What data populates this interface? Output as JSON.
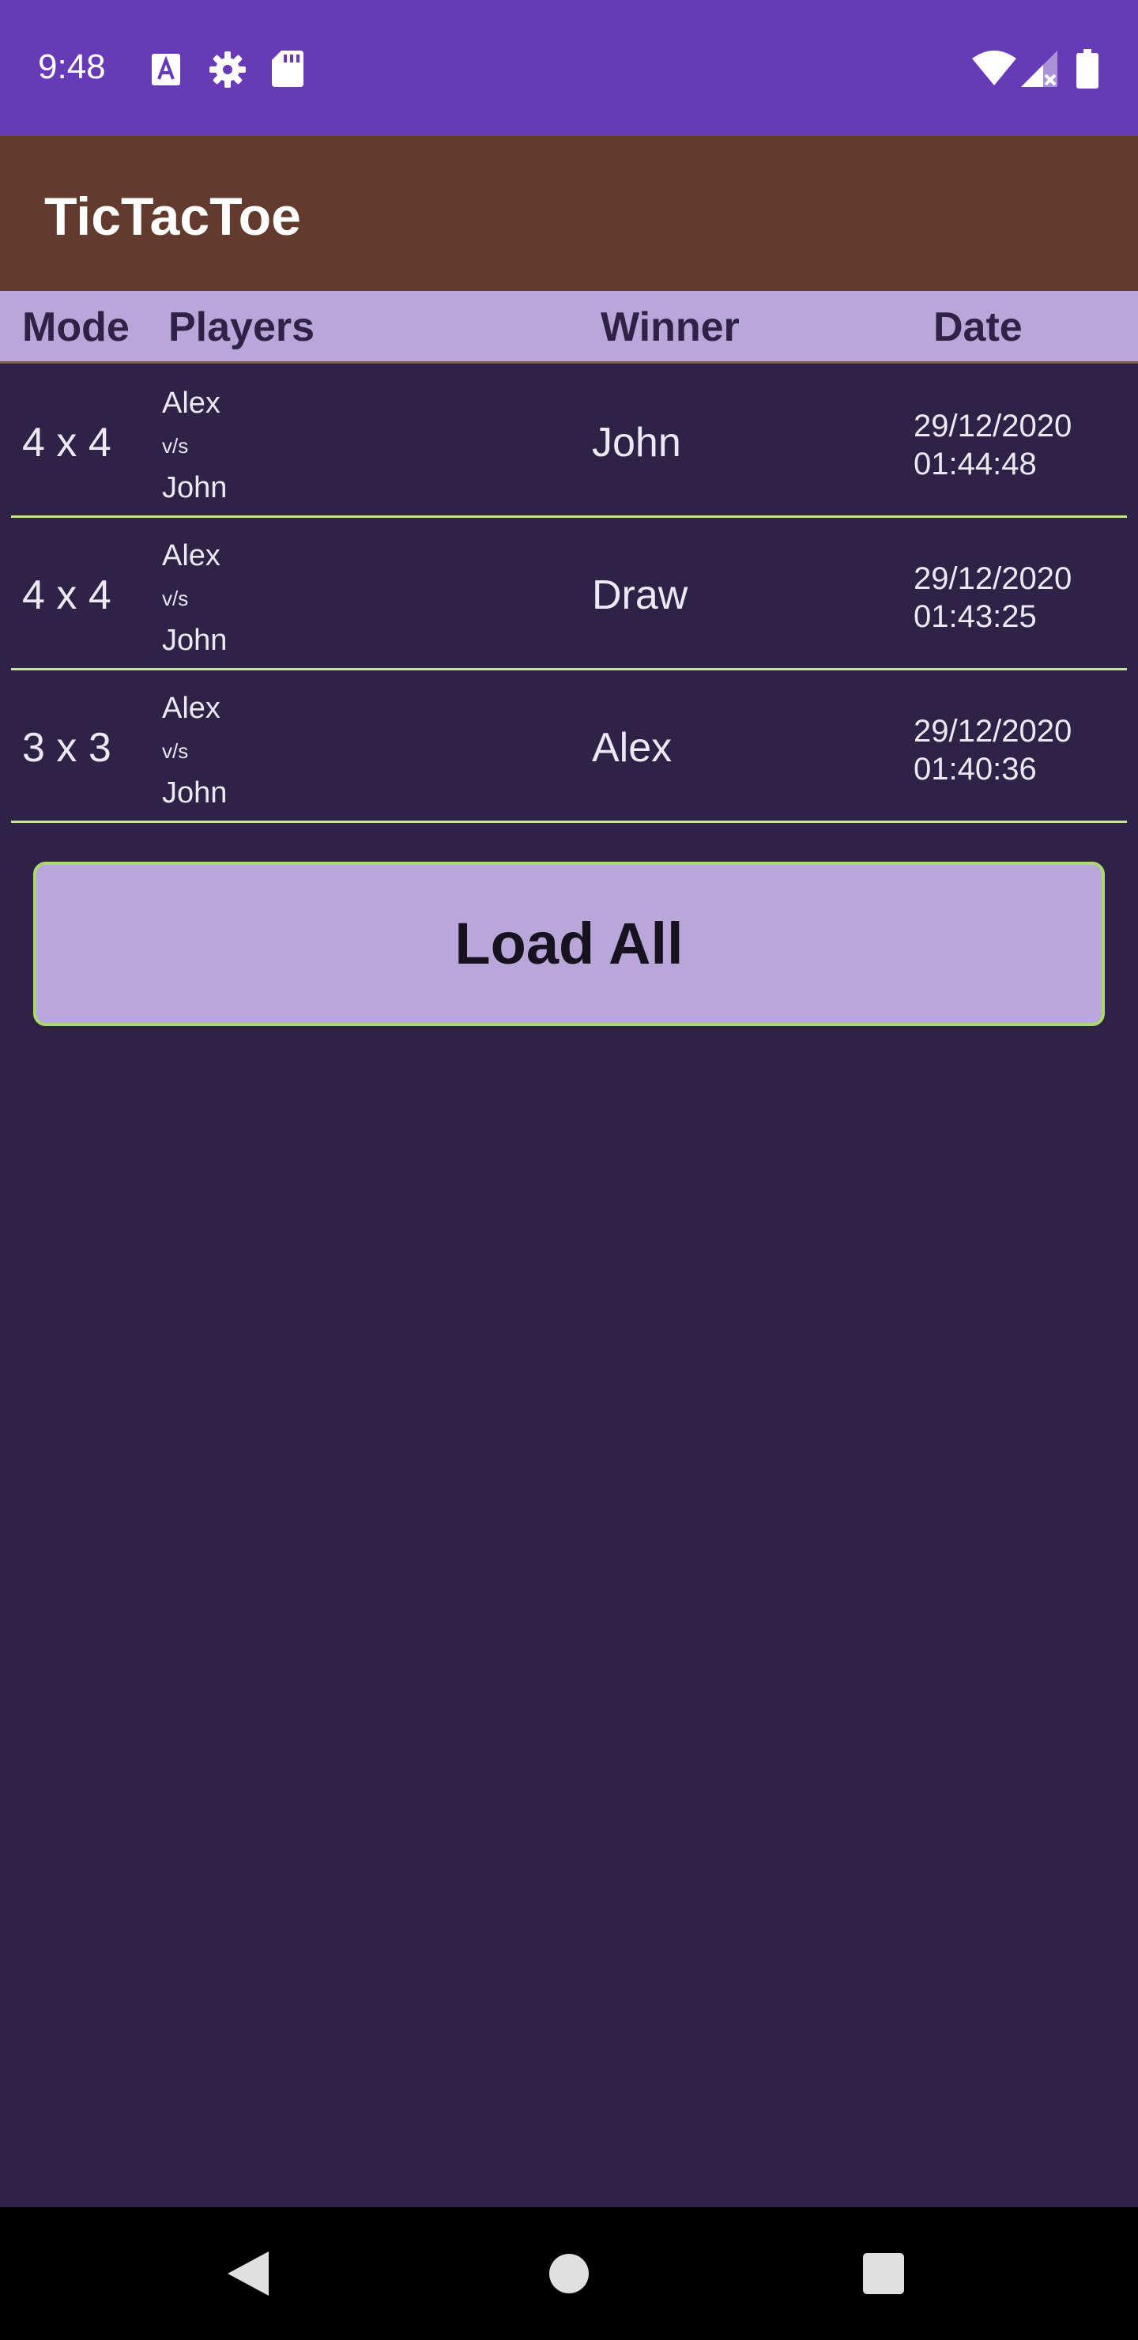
{
  "status_bar": {
    "time": "9:48",
    "left_icons": [
      "text-a-icon",
      "settings-gear-icon",
      "sd-card-icon"
    ],
    "right_icons": [
      "wifi-icon",
      "cell-signal-icon",
      "battery-icon"
    ]
  },
  "app_bar": {
    "title": "TicTacToe"
  },
  "table": {
    "headers": {
      "mode": "Mode",
      "players": "Players",
      "winner": "Winner",
      "date": "Date"
    },
    "rows": [
      {
        "mode": "4 x 4",
        "player1": "Alex",
        "vs": "v/s",
        "player2": "John",
        "winner": "John",
        "date": "29/12/2020",
        "time": "01:44:48"
      },
      {
        "mode": "4 x 4",
        "player1": "Alex",
        "vs": "v/s",
        "player2": "John",
        "winner": "Draw",
        "date": "29/12/2020",
        "time": "01:43:25"
      },
      {
        "mode": "3 x 3",
        "player1": "Alex",
        "vs": "v/s",
        "player2": "John",
        "winner": "Alex",
        "date": "29/12/2020",
        "time": "01:40:36"
      }
    ]
  },
  "load_button": {
    "label": "Load All"
  },
  "nav_bar": {
    "icons": [
      "back-icon",
      "home-icon",
      "recents-icon"
    ]
  },
  "colors": {
    "status_bar": "#673ab7",
    "app_bar": "#623b2e",
    "background": "#2e2347",
    "header": "#b9a7da",
    "divider": "#c5e59d",
    "button_border": "#a9d96f"
  }
}
